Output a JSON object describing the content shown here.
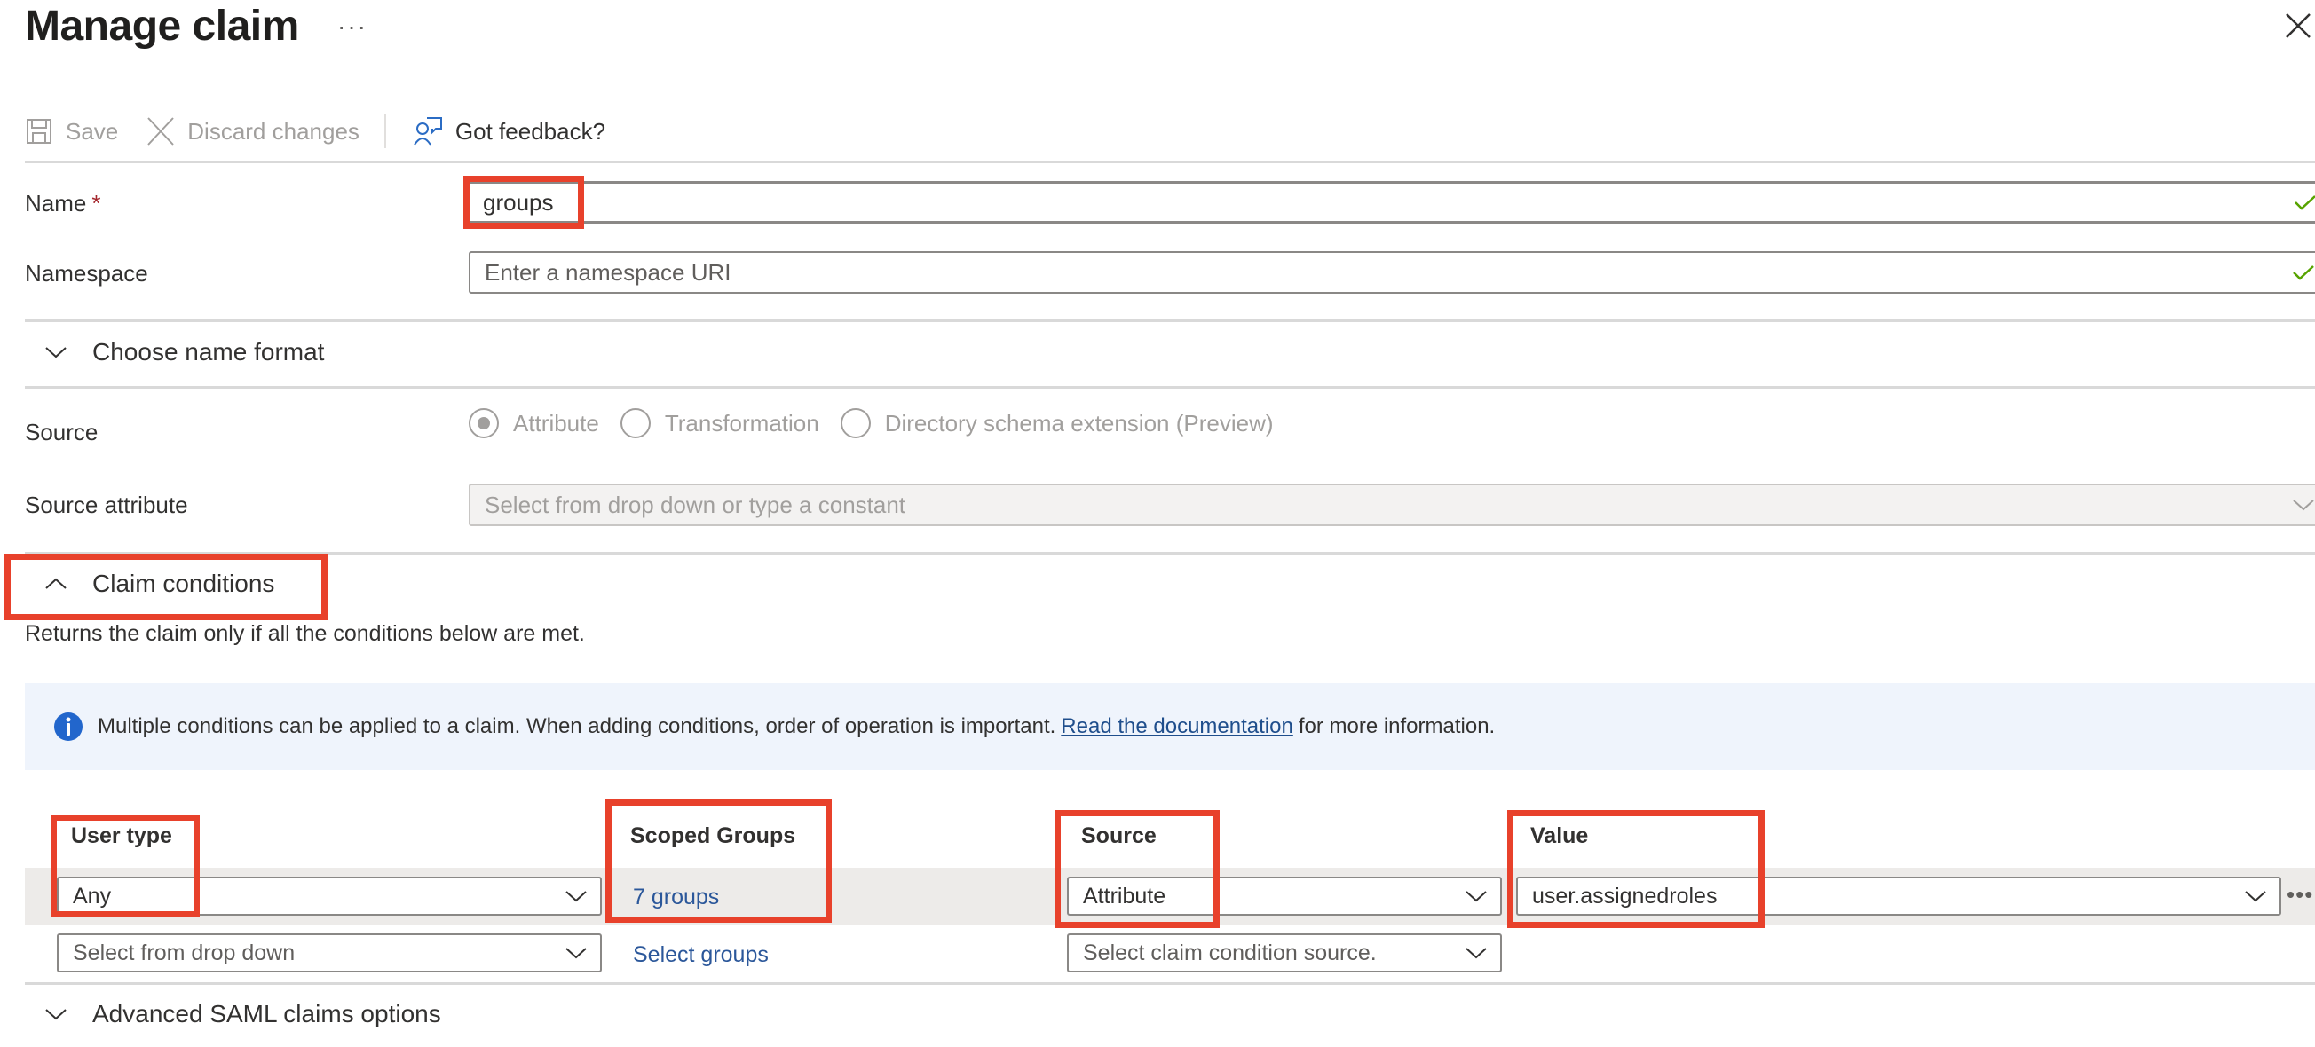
{
  "header": {
    "title": "Manage claim",
    "more_label": "···"
  },
  "toolbar": {
    "save_label": "Save",
    "discard_label": "Discard changes",
    "feedback_label": "Got feedback?"
  },
  "form": {
    "name": {
      "label": "Name",
      "required_marker": "*",
      "value": "groups",
      "valid": true
    },
    "namespace": {
      "label": "Namespace",
      "placeholder": "Enter a namespace URI",
      "valid": true
    },
    "choose_name_format": {
      "label": "Choose name format",
      "expanded": false
    },
    "source": {
      "label": "Source",
      "options": [
        {
          "label": "Attribute",
          "selected": true
        },
        {
          "label": "Transformation",
          "selected": false
        },
        {
          "label": "Directory schema extension (Preview)",
          "selected": false
        }
      ]
    },
    "source_attribute": {
      "label": "Source attribute",
      "placeholder": "Select from drop down or type a constant"
    }
  },
  "claim_conditions": {
    "label": "Claim conditions",
    "expanded": true,
    "description": "Returns the claim only if all the conditions below are met.",
    "info": {
      "text_before": "Multiple conditions can be applied to a claim.  When adding conditions, order of operation is important.",
      "link_text": "Read the documentation",
      "text_after": "for more information."
    },
    "columns": [
      "User type",
      "Scoped Groups",
      "Source",
      "Value"
    ],
    "rows": [
      {
        "user_type": "Any",
        "scoped_groups": "7 groups",
        "source": "Attribute",
        "value": "user.assignedroles"
      },
      {
        "user_type_placeholder": "Select from drop down",
        "scoped_groups": "Select groups",
        "source_placeholder": "Select claim condition source."
      }
    ],
    "row_more_label": "•••"
  },
  "advanced": {
    "label": "Advanced SAML claims options",
    "expanded": false
  },
  "colors": {
    "annotation": "#e8412b",
    "link": "#2b579a",
    "info_bg": "#eff4fc",
    "info_icon": "#2266cc",
    "valid_check": "#57a300"
  }
}
